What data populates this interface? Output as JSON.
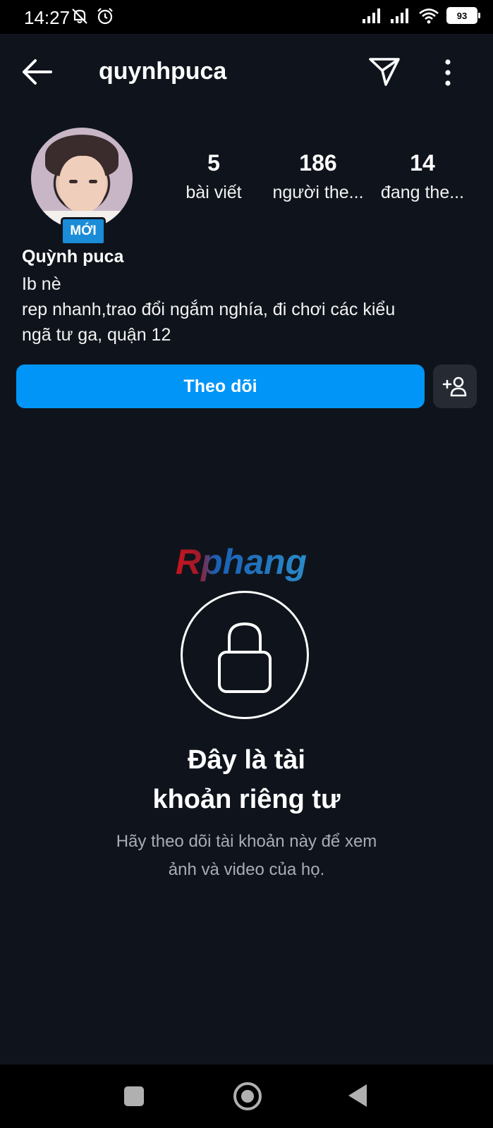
{
  "status_bar": {
    "time": "14:27",
    "battery": "93",
    "icons": [
      "mute-icon",
      "alarm-icon",
      "signal-icon",
      "signal-icon",
      "wifi-icon",
      "battery-icon"
    ]
  },
  "header": {
    "username": "quynhpuca",
    "icons": [
      "back-arrow-icon",
      "send-icon",
      "more-vertical-icon"
    ]
  },
  "profile": {
    "new_badge": "MỚI",
    "display_name": "Quỳnh puca",
    "bio": [
      "Ib nè",
      "rep nhanh,trao đổi ngắm nghía, đi chơi các kiểu",
      "ngã tư ga, quận 12"
    ],
    "stats": {
      "posts": {
        "count": "5",
        "label": "bài viết"
      },
      "followers": {
        "count": "186",
        "label": "người the..."
      },
      "following": {
        "count": "14",
        "label": "đang the..."
      }
    }
  },
  "actions": {
    "follow_label": "Theo dõi",
    "suggest_icon": "add-person-icon"
  },
  "private_notice": {
    "watermark": "Rphang",
    "title_line1": "Đây là tài",
    "title_line2": "khoản riêng tư",
    "desc_line1": "Hãy theo dõi tài khoản này để xem",
    "desc_line2": "ảnh và video của họ."
  },
  "colors": {
    "background": "#0f141c",
    "follow_button": "#0095f6",
    "badge": "#1a8cd8",
    "secondary_text": "#a8adb5"
  }
}
